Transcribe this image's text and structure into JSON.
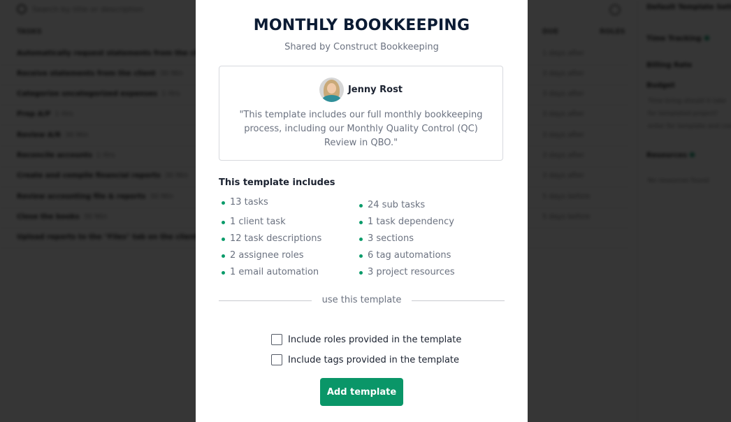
{
  "background": {
    "search_placeholder": "Search by title or description",
    "columns": [
      "TASKS",
      "DUE",
      "ROLES"
    ],
    "tasks": [
      {
        "title": "Automatically request statements from the client",
        "meta": "",
        "due": "1 days after"
      },
      {
        "title": "Receive statements from the client",
        "meta": "30 Min",
        "due": "3 days after"
      },
      {
        "title": "Categorize uncategorized expenses",
        "meta": "1 Hrs",
        "due": "3 days after"
      },
      {
        "title": "Prep A/P",
        "meta": "1 Hrs",
        "due": "3 days after"
      },
      {
        "title": "Review A/R",
        "meta": "30 Min",
        "due": "3 days after"
      },
      {
        "title": "Reconcile accounts",
        "meta": "1 Hrs",
        "due": "3 days after"
      },
      {
        "title": "Create and compile financial reports",
        "meta": "30 Min",
        "due": "3 days after"
      },
      {
        "title": "Review accounting file & reports",
        "meta": "30 Min",
        "due": "5 days before"
      },
      {
        "title": "Close the books",
        "meta": "30 Min",
        "due": "5 days before"
      },
      {
        "title": "Upload reports to the \"Files\" tab on the client profile",
        "meta": "",
        "due": ""
      }
    ],
    "settings": {
      "title": "Default Template Settings",
      "time_tracking": "Time Tracking",
      "billing_rate": "Billing Rate",
      "budget": "Budget",
      "budget_help": [
        "Time bring should it take",
        "for templated project?",
        "enter for template and costs"
      ],
      "resources": "Resources",
      "no_resources": "No resources found"
    }
  },
  "modal": {
    "title": "MONTHLY BOOKKEEPING",
    "subtitle": "Shared by Construct Bookkeeping",
    "author": {
      "name": "Jenny Rost",
      "quote": "\"This template includes our full monthly bookkeeping process, including our Monthly Quality Control (QC) Review in QBO.\""
    },
    "includes_title": "This template includes",
    "includes_left": [
      "13 tasks",
      "1 client task",
      "12 task descriptions",
      "2 assignee roles",
      "1 email automation"
    ],
    "includes_right": [
      "24 sub tasks",
      "1 task dependency",
      "3 sections",
      "6 tag automations",
      "3 project resources"
    ],
    "divider_label": "use this template",
    "options": [
      {
        "label": "Include roles provided in the template",
        "checked": false
      },
      {
        "label": "Include tags provided in the template",
        "checked": false
      }
    ],
    "add_button": "Add template"
  },
  "colors": {
    "accent": "#0a9668",
    "title": "#0b1b33",
    "muted_text": "#6b7280"
  }
}
